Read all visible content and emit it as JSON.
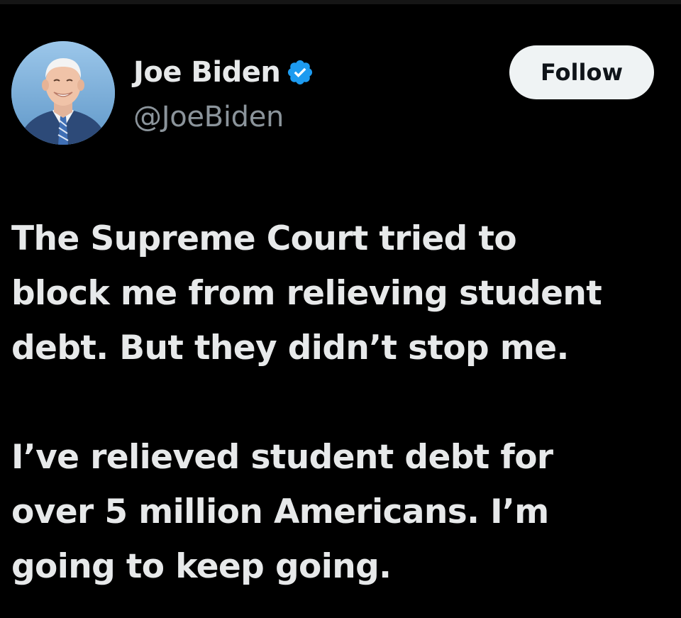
{
  "tweet": {
    "author": {
      "display_name": "Joe Biden",
      "handle": "@JoeBiden",
      "verified": true,
      "verified_icon": "verified-badge-icon",
      "avatar_icon": "profile-photo"
    },
    "follow_label": "Follow",
    "paragraphs": [
      {
        "lines": [
          "The Supreme Court tried to",
          "block me from relieving student",
          "debt. But they didn’t stop me."
        ]
      },
      {
        "lines": [
          "I’ve relieved student debt for",
          "over 5 million Americans. I’m",
          "going to keep going."
        ]
      }
    ]
  },
  "colors": {
    "background": "#000000",
    "text_primary": "#e7e9ea",
    "text_secondary": "#8b949b",
    "verified_blue": "#1d9bf0",
    "button_bg": "#eff3f4",
    "button_text": "#0f1419"
  }
}
